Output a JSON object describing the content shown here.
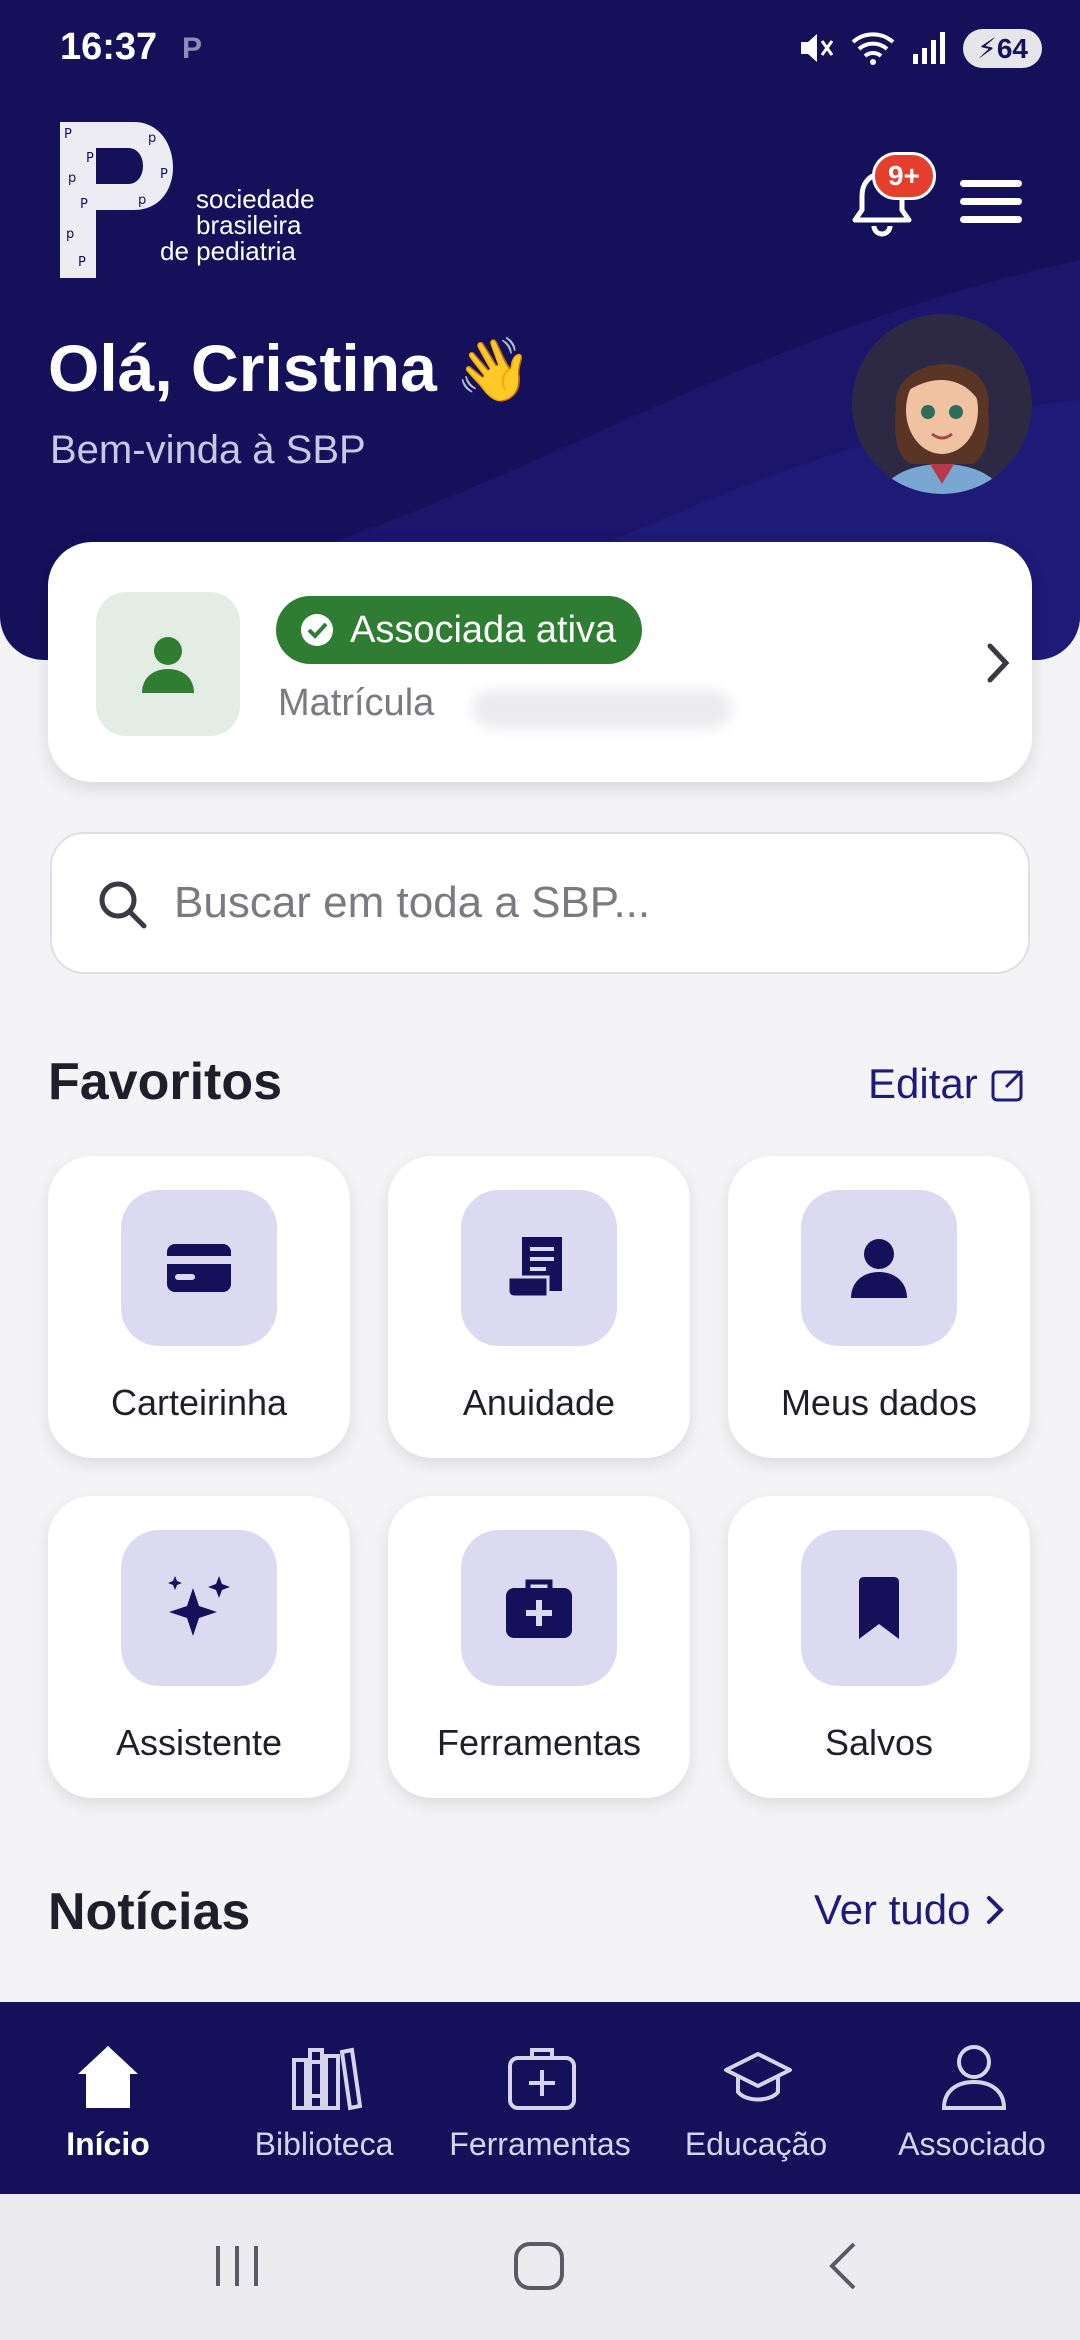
{
  "status_bar": {
    "time": "16:37",
    "carrier_icon": "P",
    "battery": "64"
  },
  "header": {
    "logo_text": [
      "sociedade",
      "brasileira",
      "de pediatria"
    ],
    "notification_badge": "9+",
    "greeting": "Olá, Cristina",
    "greeting_emoji": "👋",
    "subtitle": "Bem-vinda à SBP"
  },
  "member_card": {
    "status": "Associada ativa",
    "matricula_label": "Matrícula"
  },
  "search": {
    "placeholder": "Buscar em toda a SBP..."
  },
  "favorites": {
    "title": "Favoritos",
    "edit_label": "Editar",
    "items": [
      {
        "label": "Carteirinha",
        "icon": "card-icon"
      },
      {
        "label": "Anuidade",
        "icon": "receipt-icon"
      },
      {
        "label": "Meus dados",
        "icon": "person-icon"
      },
      {
        "label": "Assistente",
        "icon": "sparkles-icon"
      },
      {
        "label": "Ferramentas",
        "icon": "briefcase-medical-icon"
      },
      {
        "label": "Salvos",
        "icon": "bookmark-icon"
      }
    ]
  },
  "news": {
    "title": "Notícias",
    "see_all": "Ver tudo"
  },
  "bottom_nav": [
    {
      "label": "Início",
      "icon": "home-icon",
      "active": true
    },
    {
      "label": "Biblioteca",
      "icon": "library-icon"
    },
    {
      "label": "Ferramentas",
      "icon": "medical-kit-icon"
    },
    {
      "label": "Educação",
      "icon": "graduation-cap-icon"
    },
    {
      "label": "Associado",
      "icon": "user-icon"
    }
  ],
  "colors": {
    "primary": "#14105a",
    "accent_text": "#1d1a7a",
    "success": "#2f7d32",
    "badge": "#e43f2c",
    "tile_icon_bg": "#dcdaf0"
  }
}
